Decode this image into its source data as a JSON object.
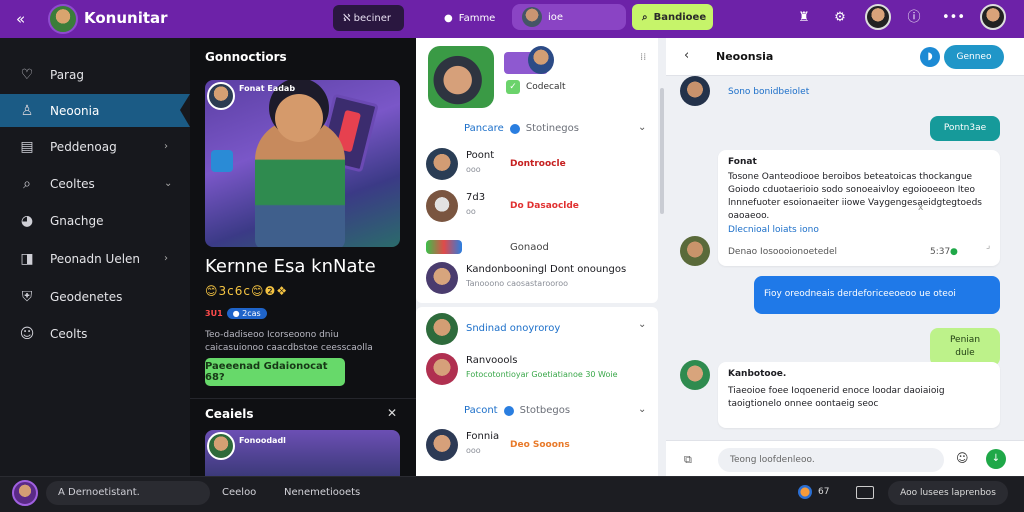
{
  "topbar": {
    "brand": "Konunitar",
    "dark_pill": "ℵ beciner",
    "user_label": "Famme",
    "search_label": "ioe",
    "green_btn": "Bandioee",
    "accent": "#6d22a8"
  },
  "sidebar": {
    "items": [
      {
        "label": "Parag",
        "icon": "heart-icon"
      },
      {
        "label": "Neoonia",
        "icon": "user-icon",
        "active": true
      },
      {
        "label": "Peddenoag",
        "icon": "inbox-icon",
        "chevron": true
      },
      {
        "label": "Ceoltes",
        "icon": "search-icon",
        "chevron": true
      },
      {
        "label": "Gnachge",
        "icon": "gamepad-icon"
      },
      {
        "label": "Peonadn Uelen",
        "icon": "bookmark-icon",
        "chevron": true
      },
      {
        "label": "Geodenetes",
        "icon": "shield-icon"
      },
      {
        "label": "Ceolts",
        "icon": "face-icon"
      }
    ]
  },
  "feature": {
    "heading": "Gonnoctiors",
    "hero_tag": "Fonat Eadab",
    "title": "Kernne Esa knNate",
    "emoji_row": "😊3c6c😊❷❖",
    "meta_red": "3U1",
    "meta_chip": "● 2cas",
    "desc": "Teo-dadiseoo Icorseoono dniu caicasuionoo caacdbstoe ceesscaolla",
    "cta": "Paeeenad Gdaionocat 68?",
    "section2": "Ceaiels",
    "hero2_tag": "Fonoodadl"
  },
  "list": {
    "badge": "Codecalt",
    "section1": {
      "primary": "Pancare",
      "secondary": "Stotinegos"
    },
    "section2": {
      "primary": "Sndinad onoyroroy",
      "secondary": ""
    },
    "section3": {
      "primary": "Pacont",
      "secondary": "Stotbegos"
    },
    "games": [
      {
        "name": "Poont",
        "sub": "ooo",
        "tag": "Dontroocle",
        "tag_color": "#c62020"
      },
      {
        "name": "7d3",
        "sub": "oo",
        "tag": "Do Dasaoclde",
        "tag_color": "#e03030"
      },
      {
        "name": "Gonaod",
        "sub": "",
        "tag": "",
        "tag_color": "#555"
      },
      {
        "name": "Kandonbooningl Dont onoungos",
        "sub": "Tanooono caosastarooroo",
        "tag": "",
        "tag_color": ""
      },
      {
        "name": "Ranvoools",
        "sub": "Fotocotontioyar Goetiatianoe 30 Woie",
        "tag": "",
        "tag_color": ""
      },
      {
        "name": "Fonnia",
        "sub": "ooo",
        "tag": "Deo Sooons",
        "tag_color": "#e87a2a"
      }
    ]
  },
  "chat": {
    "title": "Neoonsia",
    "header_btn": "Genneo",
    "first_line": "Sono bonidbeiolet",
    "messages": [
      {
        "side": "right",
        "color": "teal",
        "text": "Pontn3ae"
      },
      {
        "side": "left",
        "color": "white",
        "title": "Fonat",
        "text": "Tosone Oanteodiooe beroibos beteatoicas thockangue Goiodo cduotaerioio sodo sonoeaivloy egoiooeeon Iteo lnnnefuoter esoionaeiter iiowe Vaygengesaeidgtegtoeds oaoaeoo.",
        "suffix": "x",
        "link": "Dlecnioal loiats iono",
        "footer": "Denao Iosoooionoetedel",
        "time": "5:37"
      },
      {
        "side": "right",
        "color": "blue",
        "text": "Fioy oreodneais derdeforiceeoeoo ue oteoi"
      },
      {
        "side": "right",
        "color": "lime",
        "text": "Penian dule"
      },
      {
        "side": "left",
        "color": "white",
        "title": "Kanbotooe.",
        "text": "Tiaeoioe foee Ioqoenerid enoce loodar daoiaioig taoigtionelo onnee oontaeig seoc"
      }
    ],
    "composer_placeholder": "Teong loofdenleoo."
  },
  "bottom": {
    "input": "A Dernoetistant.",
    "link1": "Ceeloo",
    "link2": "Nenemetiooets",
    "count": "67",
    "pill": "Aoo lusees laprenbos"
  }
}
